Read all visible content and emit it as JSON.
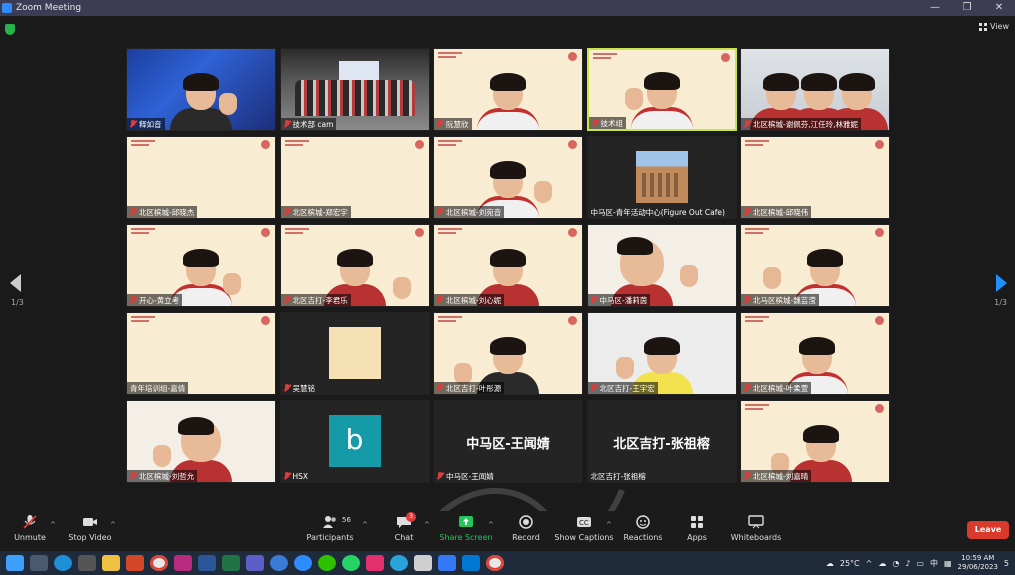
{
  "window": {
    "title": "Zoom Meeting",
    "controls": [
      "—",
      "❐",
      "✕"
    ]
  },
  "top": {
    "view_label": "View"
  },
  "pagination": {
    "left": "1/3",
    "right": "1/3"
  },
  "tiles": [
    {
      "name": "释如音"
    },
    {
      "name": "技术部 cam"
    },
    {
      "name": "阮慧欣"
    },
    {
      "name": "技术组"
    },
    {
      "name": "北区槟城-谢佩芬,江任玲,林雅妮"
    },
    {
      "name": "北区槟城-邱晓杰"
    },
    {
      "name": "北区槟城-郑宏宇"
    },
    {
      "name": "北区槟城-刘宛音"
    },
    {
      "name": "中马区-青年活动中心(Figure Out Cafe)"
    },
    {
      "name": "北区槟城-邱晓伟"
    },
    {
      "name": "开心-黄立考"
    },
    {
      "name": "北区吉打-李君乐"
    },
    {
      "name": "北区槟城-刘心妮"
    },
    {
      "name": "中马区-潘莉茵"
    },
    {
      "name": "北马区槟城-魏芸滢"
    },
    {
      "name": "青年培训组-嘉倩"
    },
    {
      "name": "吴慧铭"
    },
    {
      "name": "北区吉打-叶彤源"
    },
    {
      "name": "北区吉打-王宇宏"
    },
    {
      "name": "北区槟城-叶柔萱"
    },
    {
      "name": "北区槟城-刘哲允"
    },
    {
      "name": "HSX",
      "avatar_letter": "b"
    },
    {
      "name": "中马区-王闻婧",
      "big_name": "中马区-王闻婧"
    },
    {
      "name": "北区吉打-张祖榕",
      "big_name": "北区吉打-张祖榕"
    },
    {
      "name": "北区槟城-刘嘉晴"
    }
  ],
  "toolbar": {
    "unmute": "Unmute",
    "stop_video": "Stop Video",
    "participants": "Participants",
    "participants_count": "56",
    "chat": "Chat",
    "chat_badge": "3",
    "share_screen": "Share Screen",
    "record": "Record",
    "show_captions": "Show Captions",
    "reactions": "Reactions",
    "apps": "Apps",
    "whiteboards": "Whiteboards",
    "leave": "Leave"
  },
  "taskbar": {
    "temperature": "25°C",
    "ime": "中",
    "time": "10:59 AM",
    "date": "29/06/2023",
    "notifications": "5"
  },
  "colors": {
    "accent": "#2d8cff",
    "leave": "#d93a2b",
    "share": "#25c45a",
    "highlight": "#c8e64a"
  }
}
